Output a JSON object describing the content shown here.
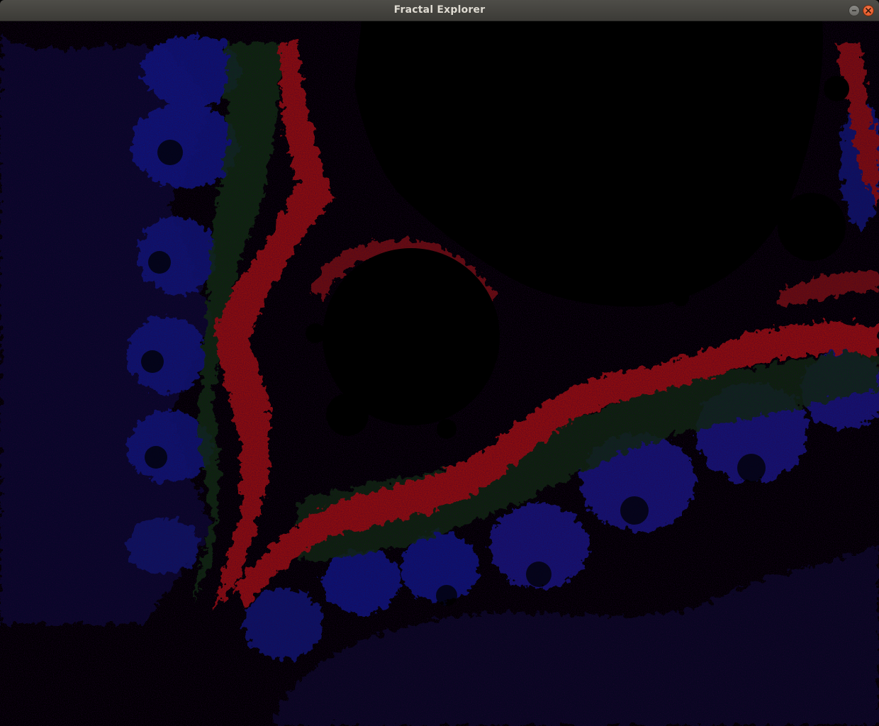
{
  "window": {
    "title": "Fractal Explorer"
  },
  "titlebar": {
    "minimize_icon": "minimize-icon",
    "close_icon": "close-icon"
  },
  "colors": {
    "background": "#000000",
    "red_band": "#8b0e0e",
    "green_band": "#0f3310",
    "blue_band": "#12167a",
    "titlebar": "#3c3b37",
    "close_button": "#e95420"
  }
}
